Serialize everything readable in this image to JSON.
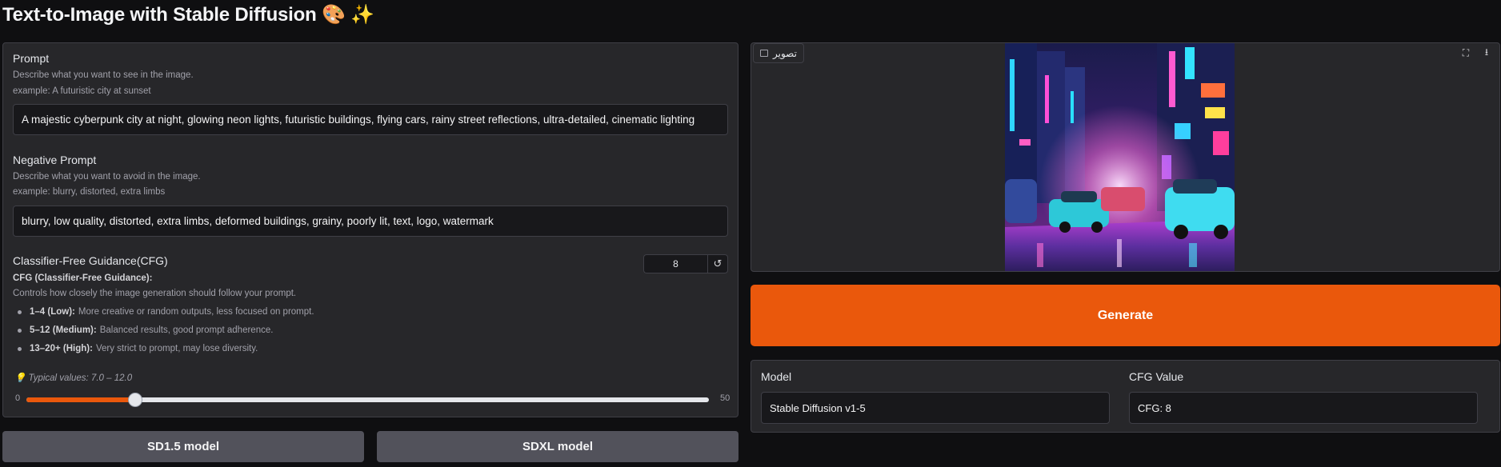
{
  "header": {
    "title": "Text-to-Image with Stable Diffusion",
    "emoji": "🎨 ✨"
  },
  "prompt": {
    "label": "Prompt",
    "info_line1": "Describe what you want to see in the image.",
    "info_line2": "example: A futuristic city at sunset",
    "value": "A majestic cyberpunk city at night, glowing neon lights, futuristic buildings, flying cars, rainy street reflections, ultra-detailed, cinematic lighting"
  },
  "negative_prompt": {
    "label": "Negative Prompt",
    "info_line1": "Describe what you want to avoid in the image.",
    "info_line2": "example: blurry, distorted, extra limbs",
    "value": "blurry, low quality, distorted, extra limbs, deformed buildings, grainy, poorly lit, text, logo, watermark"
  },
  "cfg": {
    "label": "Classifier-Free Guidance(CFG)",
    "value": "8",
    "reset_icon": "↺",
    "info_title": "CFG (Classifier-Free Guidance):",
    "info_desc": "Controls how closely the image generation should follow your prompt.",
    "items": [
      {
        "bold": "1–4 (Low):",
        "text": "More creative or random outputs, less focused on prompt."
      },
      {
        "bold": "5–12 (Medium):",
        "text": "Balanced results, good prompt adherence."
      },
      {
        "bold": "13–20+ (High):",
        "text": "Very strict to prompt, may lose diversity."
      }
    ],
    "tip_icon": "💡",
    "tip": "Typical values: 7.0 – 12.0",
    "slider": {
      "min": "0",
      "max": "50",
      "value": 8
    }
  },
  "buttons": {
    "sd15": "SD1.5 model",
    "sdxl": "SDXL model",
    "generate": "Generate"
  },
  "image_panel": {
    "label": "تصویر",
    "fullscreen_icon": "⛶",
    "download_icon": "⭳"
  },
  "output": {
    "model_label": "Model",
    "model_value": "Stable Diffusion v1-5",
    "cfg_label": "CFG Value",
    "cfg_value": "CFG: 8"
  },
  "colors": {
    "accent": "#ea580c",
    "panel": "#27272a",
    "background": "#0f0f11"
  }
}
